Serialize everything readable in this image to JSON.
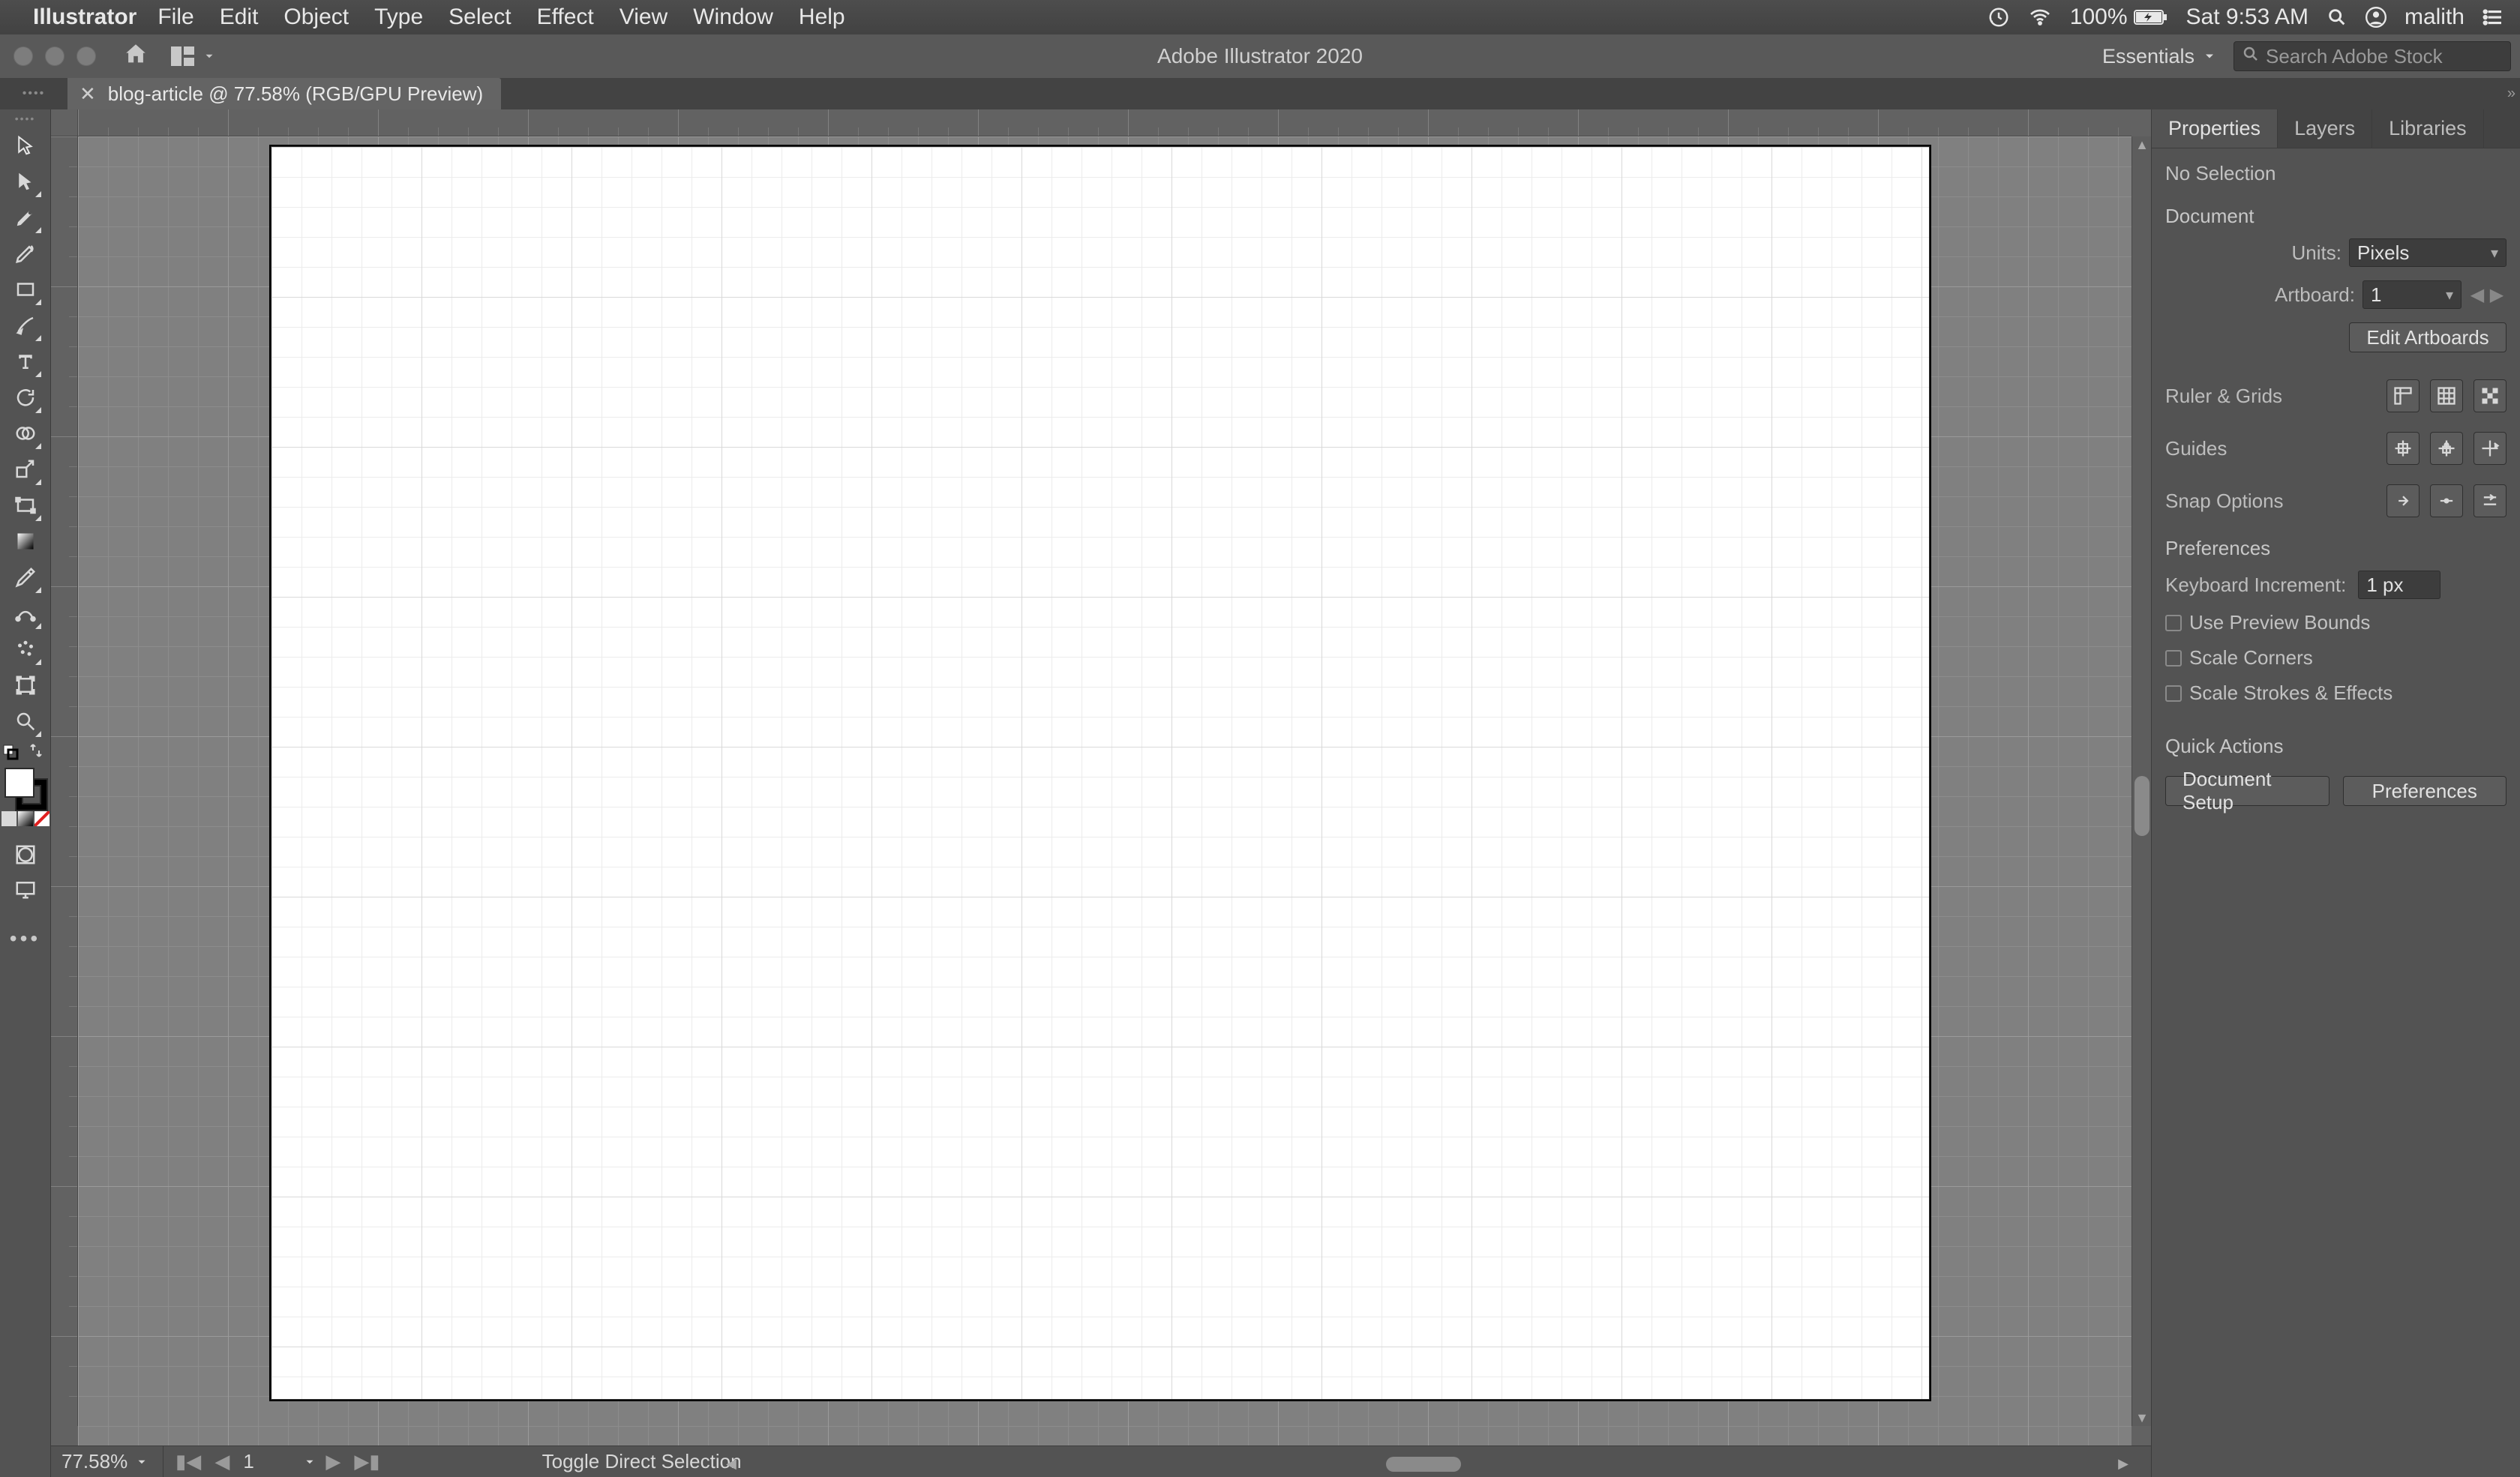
{
  "mac": {
    "appname": "Illustrator",
    "menus": [
      "File",
      "Edit",
      "Object",
      "Type",
      "Select",
      "Effect",
      "View",
      "Window",
      "Help"
    ],
    "battery": "100%",
    "clock": "Sat 9:53 AM",
    "user": "malith"
  },
  "appbar": {
    "title": "Adobe Illustrator 2020",
    "workspace": "Essentials",
    "search_placeholder": "Search Adobe Stock"
  },
  "tab": {
    "label": "blog-article @ 77.58% (RGB/GPU Preview)"
  },
  "tools": [
    "selection",
    "direct-selection",
    "pen",
    "curvature",
    "rectangle",
    "paintbrush",
    "type",
    "rotate",
    "shape-builder",
    "scale",
    "width",
    "free-transform",
    "gradient",
    "eyedropper",
    "blend",
    "symbol-sprayer",
    "artboard",
    "zoom"
  ],
  "status": {
    "zoom": "77.58%",
    "artboard_num": "1",
    "tooltip": "Toggle Direct Selection"
  },
  "panel": {
    "tabs": [
      "Properties",
      "Layers",
      "Libraries"
    ],
    "selection": "No Selection",
    "sec_document": "Document",
    "units_label": "Units:",
    "units_value": "Pixels",
    "artboard_label": "Artboard:",
    "artboard_value": "1",
    "edit_artboards": "Edit Artboards",
    "ruler_grids": "Ruler & Grids",
    "guides": "Guides",
    "snap_options": "Snap Options",
    "sec_preferences": "Preferences",
    "keyboard_inc_label": "Keyboard Increment:",
    "keyboard_inc_value": "1 px",
    "cb_preview": "Use Preview Bounds",
    "cb_corners": "Scale Corners",
    "cb_strokes": "Scale Strokes & Effects",
    "quick_actions": "Quick Actions",
    "doc_setup": "Document Setup",
    "preferences_btn": "Preferences"
  }
}
